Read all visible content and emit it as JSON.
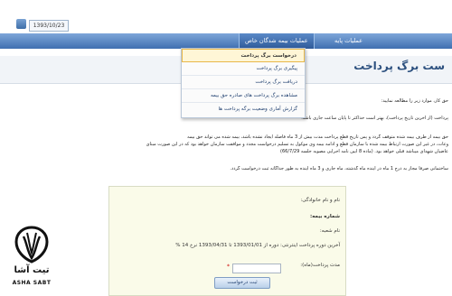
{
  "header": {
    "date": "1393/10/23"
  },
  "nav": {
    "items": [
      {
        "label": "عملیات پایه"
      },
      {
        "label": "عملیات بیمه شدگان خاص"
      }
    ]
  },
  "dropdown": {
    "items": [
      {
        "label": "درخواست برگ پرداخت"
      },
      {
        "label": "پیگیری برگ پرداخت"
      },
      {
        "label": "دریافت برگ پرداخت"
      },
      {
        "label": "مشاهده برگ پرداخت های صادره حق بیمه"
      },
      {
        "label": "گزارش آماری وضعیت برگه پرداخت ها"
      }
    ]
  },
  "page": {
    "title": "ست برگ پرداخت",
    "intro": "حق کار، موارد زیر را مطالعه نمایید:",
    "paragraphs": [
      "پرداخت (از آخرین تاریخ پرداخت)، بهتر است حداکثر تا پایان ساعت جاری باشد.",
      "حق بیمه از طرف بیمه شده متوقف گردد و پس تاریخ قطع پرداخت مدت بیش از 3 ماه فاصله ایجاد نشده باشد، بیمه شده می تواند حق بیمه",
      "وعات، در غیر این صورت ارتباط بیمه شده با سازمان قطع و ادامه بیمه وی موکول به تسلیم درخواست مجدد و موافقت سازمان خواهد بود که در این صورت مبنای",
      "عاضیان شهدای میباشد قبلی خواهد بود. (ماده 8 آیین نامه اجرایی مصوبه جلسه 66/7/29)",
      "ساختمانی صرفا مجاز به درج 1 ماه در آینده ماه گذشته، ماه جاری و 3 ماه آینده به طور جداگانه ثبت درخواست گردد."
    ]
  },
  "form": {
    "name_label": "نام و نام خانوادگی:",
    "insurance_label": "شماره بیمه:",
    "national_id_label": "نام شعبه:",
    "last_period_label": "آخرین دوره پرداخت اینترنتی: دوره از 1393/01/01 تا 1393/04/31 نرخ 14 %",
    "payment_period_label": "مدت پرداخت(ماه):",
    "submit_label": "ثبت درخواست"
  },
  "logo": {
    "fa": "تیت آشا",
    "en": "ASHA SABT"
  }
}
